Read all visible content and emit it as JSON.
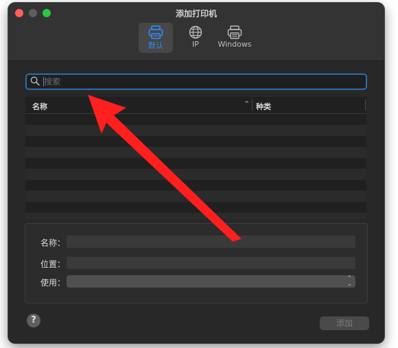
{
  "window": {
    "title": "添加打印机"
  },
  "toolbar": {
    "tabs": [
      {
        "label": "默认",
        "icon": "printer-icon",
        "active": true
      },
      {
        "label": "IP",
        "icon": "globe-icon",
        "active": false
      },
      {
        "label": "Windows",
        "icon": "windows-printer-icon",
        "active": false
      }
    ]
  },
  "search": {
    "placeholder": "搜索",
    "value": ""
  },
  "table": {
    "columns": [
      {
        "label": "名称",
        "sorted": "ascending"
      },
      {
        "label": "种类"
      }
    ],
    "rows": []
  },
  "details": {
    "name_label": "名称：",
    "location_label": "位置：",
    "use_label": "使用：",
    "name_value": "",
    "location_value": "",
    "use_value": ""
  },
  "footer": {
    "help_label": "?",
    "add_label": "添加"
  },
  "colors": {
    "accent": "#2f8cff",
    "annotation_arrow": "#ff1f1f"
  }
}
